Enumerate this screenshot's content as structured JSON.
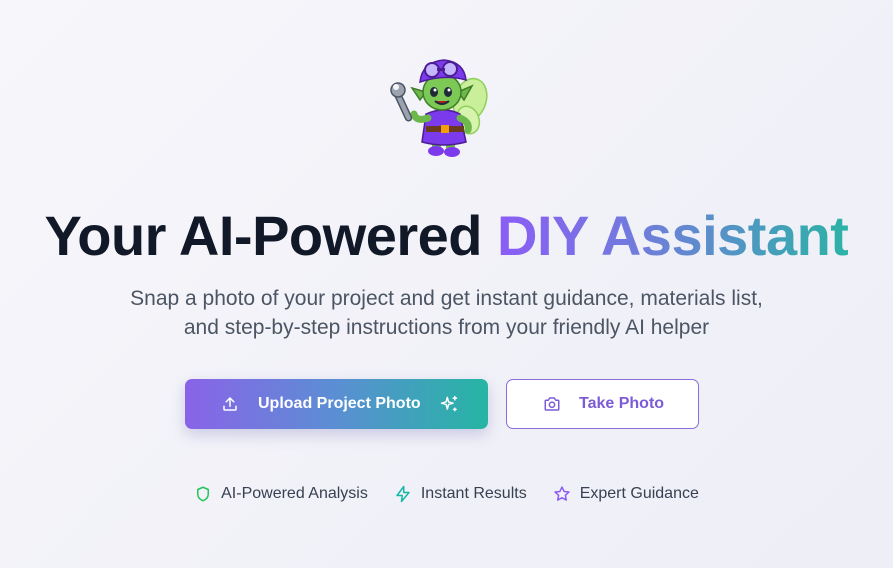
{
  "hero": {
    "mascot_icon": "fairy-mechanic-mascot-icon",
    "headline": {
      "prefix": "Your AI-Powered ",
      "accent": "DIY Assistant"
    },
    "subtitle": {
      "line1": "Snap a photo of your project and get instant guidance, materials list,",
      "line2": "and step-by-step instructions from your friendly AI helper"
    }
  },
  "actions": {
    "upload": {
      "label": "Upload Project Photo",
      "icon": "upload-icon",
      "trailing_icon": "sparkles-icon"
    },
    "camera": {
      "label": "Take Photo",
      "icon": "camera-icon"
    }
  },
  "features": [
    {
      "label": "AI-Powered Analysis",
      "icon": "shield-icon",
      "color": "#22c55e"
    },
    {
      "label": "Instant Results",
      "icon": "lightning-icon",
      "color": "#14b8a6"
    },
    {
      "label": "Expert Guidance",
      "icon": "star-icon",
      "color": "#8b5cf6"
    }
  ],
  "colors": {
    "accent_start": "#8b5cf6",
    "accent_end": "#2bb3a6",
    "outline_button": "#7c5cd6"
  }
}
